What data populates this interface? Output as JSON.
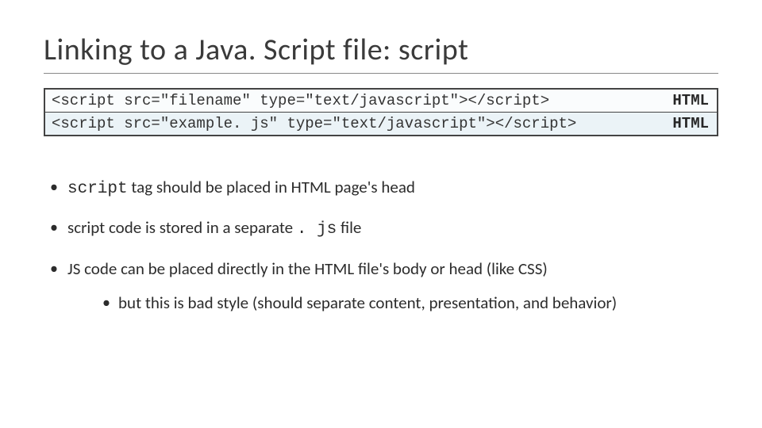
{
  "title": "Linking to a Java. Script file: script",
  "code_rows": [
    {
      "code": "<script src=\"filename\" type=\"text/javascript\"></script>",
      "lang": "HTML"
    },
    {
      "code": "<script src=\"example. js\" type=\"text/javascript\"></script>",
      "lang": "HTML"
    }
  ],
  "bullets": {
    "b1_mono": "script",
    "b1_rest": " tag should be placed in HTML page's head",
    "b2_pre": "script code is stored in a separate ",
    "b2_mono": ". js",
    "b2_post": " file",
    "b3": "JS code can be placed directly in the HTML file's body or head (like CSS)",
    "b3_sub": "but this is bad style (should separate content, presentation, and behavior)"
  }
}
